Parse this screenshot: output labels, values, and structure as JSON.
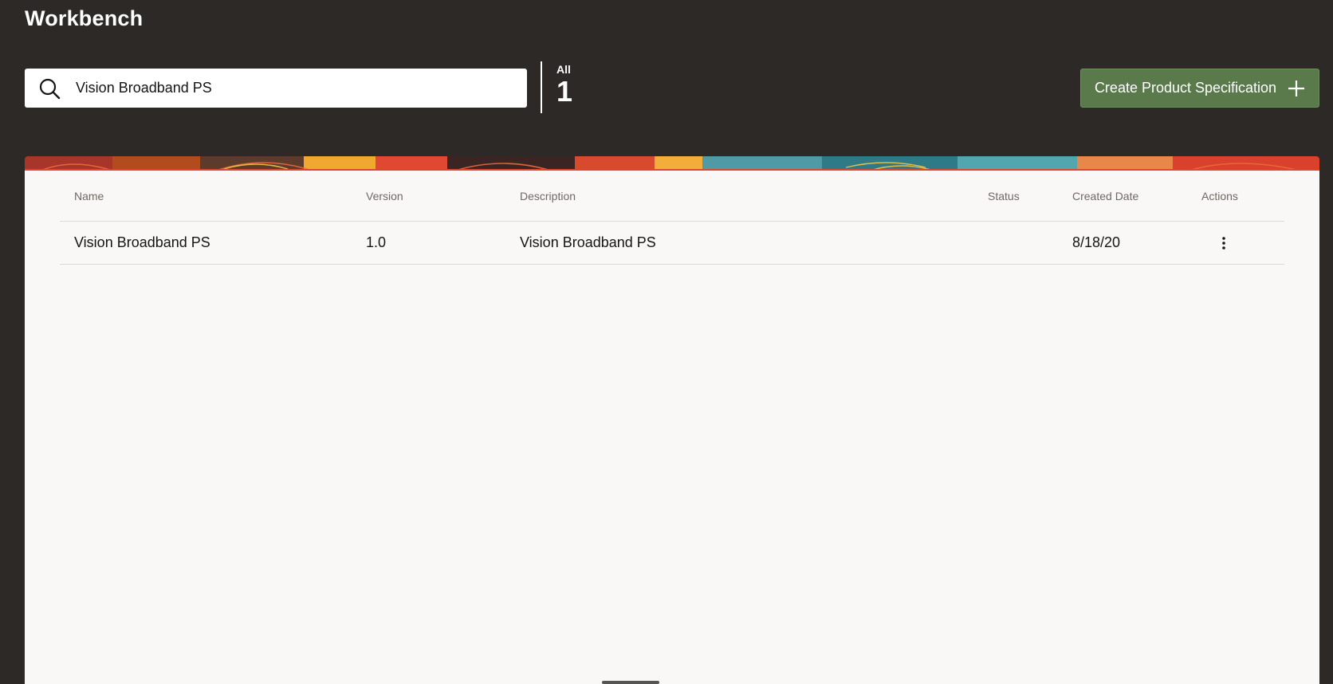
{
  "header": {
    "title": "Workbench"
  },
  "search": {
    "value": "Vision Broadband PS",
    "icon": "search-icon"
  },
  "count": {
    "label": "All",
    "value": "1"
  },
  "create_button": {
    "label": "Create Product Specification",
    "icon": "plus-icon",
    "color": "#5a7a4c"
  },
  "table": {
    "headers": [
      "Name",
      "Version",
      "Description",
      "Status",
      "Created Date",
      "Actions"
    ],
    "rows": [
      {
        "name": "Vision Broadband PS",
        "version": "1.0",
        "description": "Vision Broadband PS",
        "status": "",
        "created_date": "8/18/20",
        "actions_icon": "kebab-menu-icon"
      }
    ]
  },
  "colors": {
    "background": "#2d2926",
    "panel": "#f9f8f6",
    "accent_green": "#5a7a4c"
  }
}
